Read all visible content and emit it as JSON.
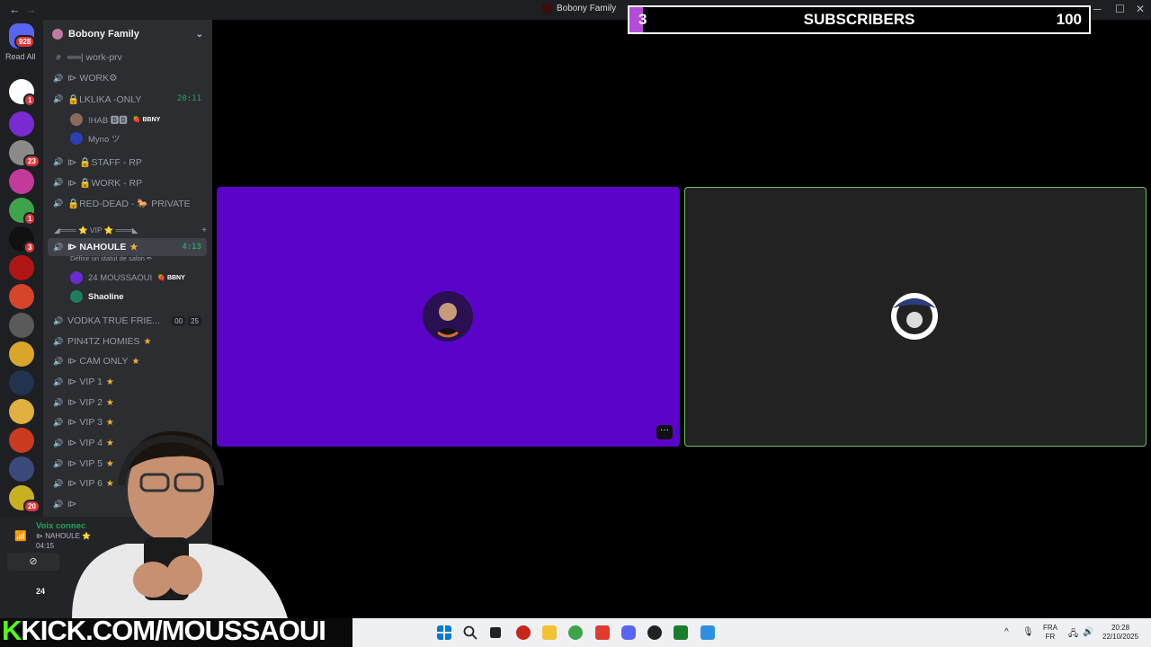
{
  "window": {
    "title": "Bobony Family",
    "back_icon": "←",
    "forward_icon": "→",
    "minimize": "─",
    "maximize": "☐",
    "close": "✕"
  },
  "rail": {
    "home_badge": "928",
    "read_all": "Read All",
    "servers": [
      {
        "name": "server-1",
        "badge": "1",
        "color": "#ffffff"
      },
      {
        "name": "server-fucl",
        "badge": "",
        "color": "#7a2ad1"
      },
      {
        "name": "server-3",
        "badge": "23",
        "color": "#8a8a8a"
      },
      {
        "name": "server-4",
        "badge": "",
        "color": "#c23b9a"
      },
      {
        "name": "server-5",
        "badge": "1",
        "color": "#3ea34a"
      },
      {
        "name": "server-6",
        "badge": "3",
        "color": "#111111"
      },
      {
        "name": "server-7",
        "badge": "",
        "color": "#b01515"
      },
      {
        "name": "server-8",
        "badge": "",
        "color": "#d6442a"
      },
      {
        "name": "server-9",
        "badge": "",
        "color": "#5a5a5a"
      },
      {
        "name": "server-10",
        "badge": "",
        "color": "#d9a62b"
      },
      {
        "name": "server-11",
        "badge": "",
        "color": "#22334d"
      },
      {
        "name": "server-12",
        "badge": "",
        "color": "#e0b040"
      },
      {
        "name": "server-13",
        "badge": "",
        "color": "#c93a1f"
      },
      {
        "name": "server-14",
        "badge": "",
        "color": "#3a4a7a"
      },
      {
        "name": "server-15",
        "badge": "20",
        "color": "#c8b020"
      }
    ]
  },
  "sidebar": {
    "server_name": "Bobony Family",
    "channels": [
      {
        "label": "══| work-prv",
        "type": "text"
      },
      {
        "label": "⧐ WORK⚙",
        "type": "voice"
      },
      {
        "label": "🔒LKLIKA -ONLY",
        "type": "voice",
        "live": true,
        "time": "20:11"
      },
      {
        "label": "⧐ 🔒STAFF - RP",
        "type": "voice"
      },
      {
        "label": "⧐ 🔒WORK - RP",
        "type": "voice"
      },
      {
        "label": "🔒RED-DEAD - 🐎 PRIVATE",
        "type": "voice"
      }
    ],
    "lklika_members": [
      {
        "name": "!HAB 🅱🅱",
        "tag": "🍓 BBNY"
      },
      {
        "name": "Myno ツ",
        "tag": ""
      }
    ],
    "category": "◢═══ ⭐ VIP ⭐ ═══◣",
    "category_plus": "+",
    "active_channel": {
      "label": "⧐ NAHOULE",
      "time": "4:13",
      "status": "Définir un statut de salon ✏"
    },
    "active_members": [
      {
        "name": "24 MOUSSAOUI",
        "tag": "🍓 BBNY"
      },
      {
        "name": "Shaoline",
        "tag": ""
      }
    ],
    "vip_channels": [
      {
        "label": "VODKA TRUE FRIE...",
        "counts": [
          "00",
          "25"
        ]
      },
      {
        "label": "PIN4TZ HOMIES",
        "star": true
      },
      {
        "label": "⧐ CAM ONLY",
        "star": true
      },
      {
        "label": "⧐ VIP 1",
        "star": true
      },
      {
        "label": "⧐ VIP 2",
        "star": true
      },
      {
        "label": "⧐ VIP 3",
        "star": true
      },
      {
        "label": "⧐ VIP 4",
        "star": true
      },
      {
        "label": "⧐ VIP 5",
        "star": true
      },
      {
        "label": "⧐ VIP 6",
        "star": true
      },
      {
        "label": "⧐",
        "star": false
      }
    ]
  },
  "voice_panel": {
    "status": "Voix connec",
    "channel": "⧐ NAHOULE ⭐",
    "elapsed": "04:15",
    "user": "24"
  },
  "overlay": {
    "current": "3",
    "label": "SUBSCRIBERS",
    "goal": "100",
    "progress": 0.03,
    "accent": "#b34dd9"
  },
  "tiles": {
    "more_label": "···"
  },
  "branding": {
    "k": "K",
    "text": "KICK.COM/MOUSSAOUI",
    "color": "#53fc18"
  },
  "taskbar": {
    "lang_top": "FRA",
    "lang_bottom": "FR",
    "time": "20:28",
    "date": "22/10/2025",
    "chevron": "^"
  }
}
